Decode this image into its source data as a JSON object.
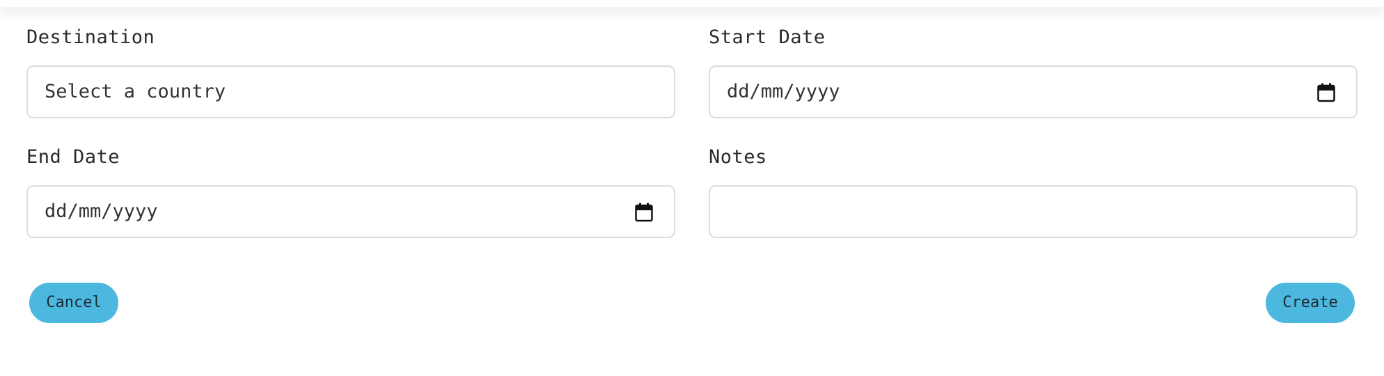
{
  "form": {
    "destination": {
      "label": "Destination",
      "placeholder": "Select a country"
    },
    "start_date": {
      "label": "Start Date",
      "placeholder": "dd/mm/yyyy",
      "icon": "calendar-icon"
    },
    "end_date": {
      "label": "End Date",
      "placeholder": "dd/mm/yyyy",
      "icon": "calendar-icon"
    },
    "notes": {
      "label": "Notes",
      "value": ""
    }
  },
  "actions": {
    "cancel_label": "Cancel",
    "create_label": "Create"
  },
  "colors": {
    "button_bg": "#4db8df",
    "field_border": "#dcdcdc",
    "text": "#222222"
  }
}
